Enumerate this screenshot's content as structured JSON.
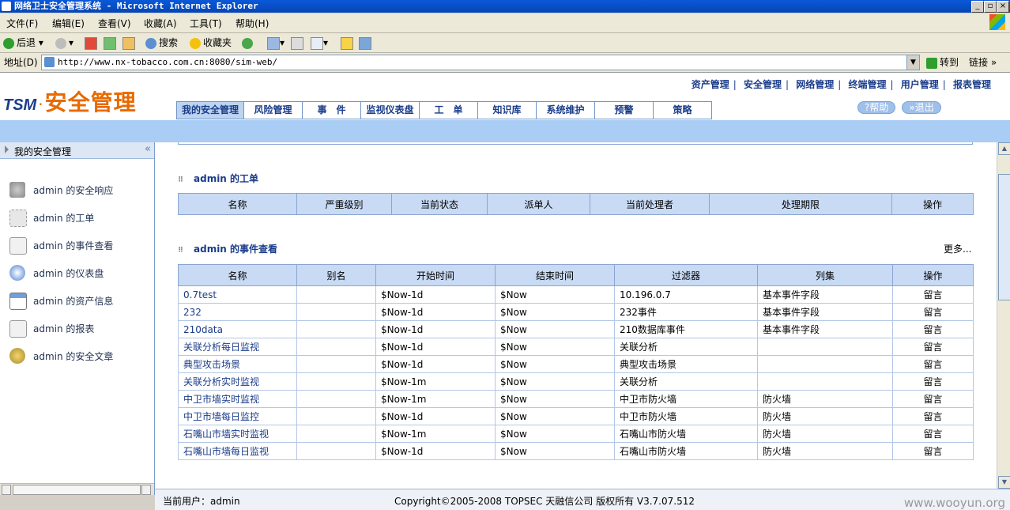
{
  "window": {
    "title": "网络卫士安全管理系统 - Microsoft Internet Explorer"
  },
  "menu": [
    "文件(F)",
    "编辑(E)",
    "查看(V)",
    "收藏(A)",
    "工具(T)",
    "帮助(H)"
  ],
  "toolbar": {
    "back": "后退",
    "search": "搜索",
    "favorites": "收藏夹"
  },
  "address": {
    "label": "地址(D)",
    "url": "http://www.nx-tobacco.com.cn:8080/sim-web/",
    "go": "转到",
    "links": "链接"
  },
  "logo": {
    "brand": "TSM",
    "dot": "·",
    "name": "安全管理"
  },
  "top_links": [
    "资产管理",
    "安全管理",
    "网络管理",
    "终端管理",
    "用户管理",
    "报表管理"
  ],
  "header_buttons": {
    "help": "?帮助",
    "logout": "»退出"
  },
  "nav_tabs": [
    "我的安全管理",
    "风险管理",
    "事　件",
    "监视仪表盘",
    "工　单",
    "知识库",
    "系统维护",
    "预警",
    "策略"
  ],
  "sidebar": {
    "title": "我的安全管理",
    "collapse": "«",
    "items": [
      {
        "label": "admin 的安全响应",
        "icon": "speaker-icon"
      },
      {
        "label": "admin 的工单",
        "icon": "worksheet-icon"
      },
      {
        "label": "admin 的事件查看",
        "icon": "clipboard-icon"
      },
      {
        "label": "admin 的仪表盘",
        "icon": "compass-icon"
      },
      {
        "label": "admin 的资产信息",
        "icon": "window-icon"
      },
      {
        "label": "admin 的报表",
        "icon": "report-icon"
      },
      {
        "label": "admin 的安全文章",
        "icon": "article-icon"
      }
    ]
  },
  "worklist": {
    "title": "admin 的工单",
    "columns": [
      "名称",
      "严重级别",
      "当前状态",
      "派单人",
      "当前处理者",
      "处理期限",
      "操作"
    ]
  },
  "events": {
    "title": "admin 的事件查看",
    "more": "更多...",
    "columns": [
      "名称",
      "别名",
      "开始时间",
      "结束时间",
      "过滤器",
      "列集",
      "操作"
    ],
    "rows": [
      [
        "0.7test",
        "",
        "$Now-1d",
        "$Now",
        "10.196.0.7",
        "基本事件字段",
        "留言"
      ],
      [
        "232",
        "",
        "$Now-1d",
        "$Now",
        "232事件",
        "基本事件字段",
        "留言"
      ],
      [
        "210data",
        "",
        "$Now-1d",
        "$Now",
        "210数据库事件",
        "基本事件字段",
        "留言"
      ],
      [
        "关联分析每日监视",
        "",
        "$Now-1d",
        "$Now",
        "关联分析",
        "",
        "留言"
      ],
      [
        "典型攻击场景",
        "",
        "$Now-1d",
        "$Now",
        "典型攻击场景",
        "",
        "留言"
      ],
      [
        "关联分析实时监视",
        "",
        "$Now-1m",
        "$Now",
        "关联分析",
        "",
        "留言"
      ],
      [
        "中卫市墙实时监视",
        "",
        "$Now-1m",
        "$Now",
        "中卫市防火墙",
        "防火墙",
        "留言"
      ],
      [
        "中卫市墙每日监控",
        "",
        "$Now-1d",
        "$Now",
        "中卫市防火墙",
        "防火墙",
        "留言"
      ],
      [
        "石嘴山市墙实时监视",
        "",
        "$Now-1m",
        "$Now",
        "石嘴山市防火墙",
        "防火墙",
        "留言"
      ],
      [
        "石嘴山市墙每日监视",
        "",
        "$Now-1d",
        "$Now",
        "石嘴山市防火墙",
        "防火墙",
        "留言"
      ]
    ]
  },
  "status": {
    "user": "当前用户：admin",
    "copyright": "Copyright©2005-2008 TOPSEC 天融信公司  版权所有  V3.7.07.512",
    "watermark": "www.wooyun.org"
  }
}
